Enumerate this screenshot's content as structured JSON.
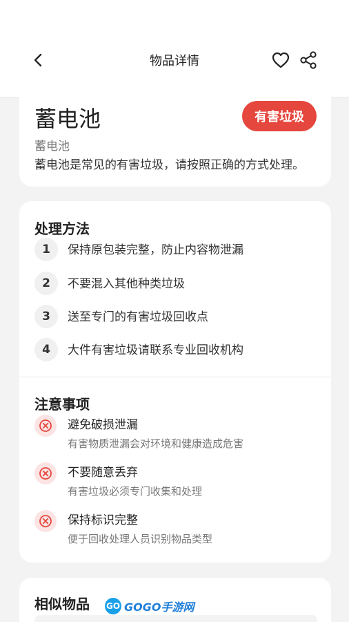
{
  "header": {
    "title": "物品详情",
    "back_icon": "chevron-left-icon",
    "favorite_icon": "heart-icon",
    "share_icon": "share-icon"
  },
  "item": {
    "name": "蓄电池",
    "category_badge": "有害垃圾",
    "badge_color": "#e5473e",
    "subtitle": "蓄电池",
    "description": "蓄电池是常见的有害垃圾，请按照正确的方式处理。"
  },
  "disposal": {
    "title": "处理方法",
    "steps": [
      {
        "num": "1",
        "text": "保持原包装完整，防止内容物泄漏"
      },
      {
        "num": "2",
        "text": "不要混入其他种类垃圾"
      },
      {
        "num": "3",
        "text": "送至专门的有害垃圾回收点"
      },
      {
        "num": "4",
        "text": "大件有害垃圾请联系专业回收机构"
      }
    ]
  },
  "notes": {
    "title": "注意事项",
    "items": [
      {
        "title": "避免破损泄漏",
        "desc": "有害物质泄漏会对环境和健康造成危害"
      },
      {
        "title": "不要随意丢弃",
        "desc": "有害垃圾必须专门收集和处理"
      },
      {
        "title": "保持标识完整",
        "desc": "便于回收处理人员识别物品类型"
      }
    ]
  },
  "similar": {
    "title": "相似物品"
  },
  "watermark": {
    "logo": "GO",
    "text": "GOGO手游网"
  }
}
